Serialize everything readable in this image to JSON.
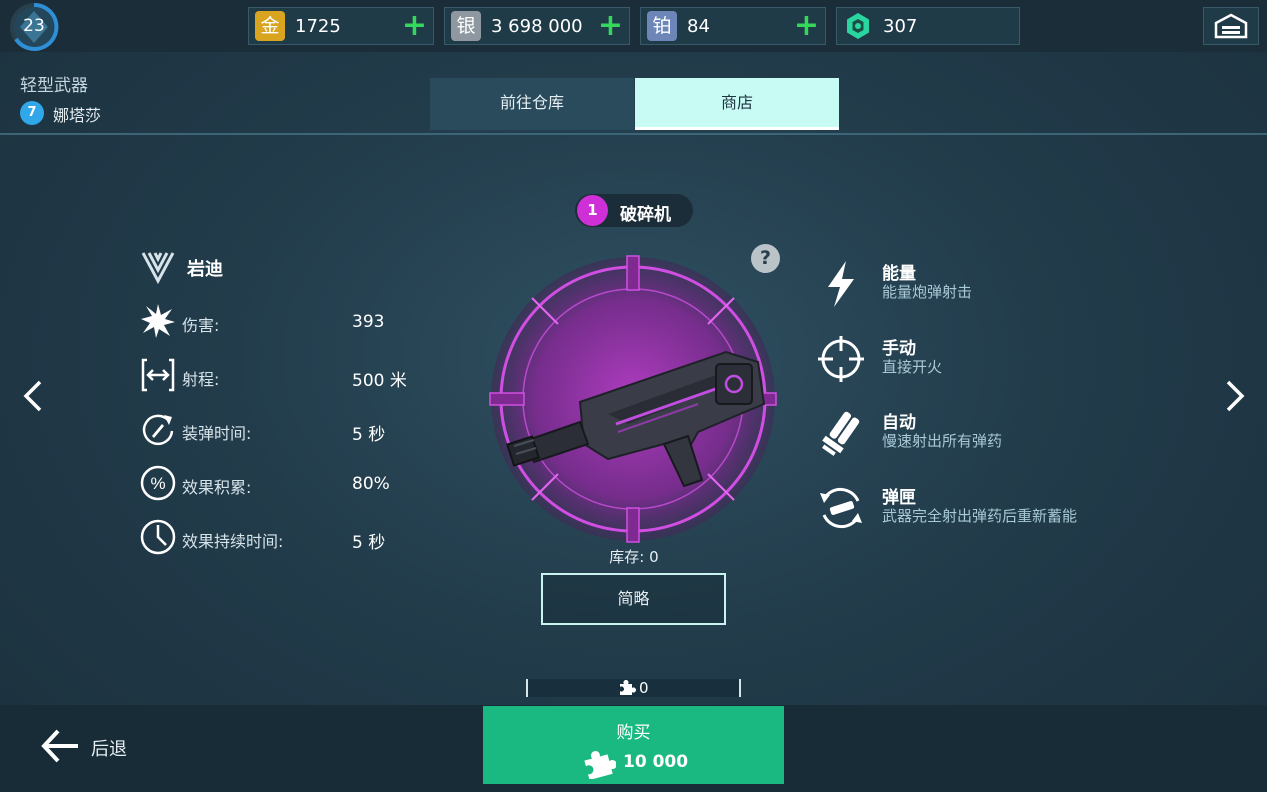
{
  "player": {
    "level": "23"
  },
  "currencies": [
    {
      "icon": "gold-icon",
      "glyph": "金",
      "value": "1725",
      "color": "#d9a521",
      "can_add": true
    },
    {
      "icon": "silver-icon",
      "glyph": "银",
      "value": "3 698 000",
      "color": "#8f98a0",
      "can_add": true
    },
    {
      "icon": "platinum-icon",
      "glyph": "铂",
      "value": "84",
      "color": "#6d86b8",
      "can_add": true
    },
    {
      "icon": "gem-icon",
      "glyph": "",
      "value": "307",
      "color": "#2ad6a0",
      "can_add": false
    }
  ],
  "header": {
    "category": "轻型武器",
    "pilot_level": "7",
    "pilot_name": "娜塔莎",
    "tabs": [
      {
        "label": "前往仓库",
        "active": false
      },
      {
        "label": "商店",
        "active": true
      }
    ]
  },
  "weapon": {
    "rank": "1",
    "name": "破碎机",
    "manufacturer": "岩迪",
    "stats": [
      {
        "icon": "damage-icon",
        "label": "伤害:",
        "value": "393"
      },
      {
        "icon": "range-icon",
        "label": "射程:",
        "value": "500 米"
      },
      {
        "icon": "reload-icon",
        "label": "装弹时间:",
        "value": "5 秒"
      },
      {
        "icon": "percent-icon",
        "label": "效果积累:",
        "value": "80%"
      },
      {
        "icon": "timer-icon",
        "label": "效果持续时间:",
        "value": "5 秒"
      }
    ],
    "features": [
      {
        "icon": "lightning-icon",
        "title": "能量",
        "desc": "能量炮弹射击"
      },
      {
        "icon": "crosshair-icon",
        "title": "手动",
        "desc": "直接开火"
      },
      {
        "icon": "auto-fire-icon",
        "title": "自动",
        "desc": "慢速射出所有弹药"
      },
      {
        "icon": "magazine-icon",
        "title": "弹匣",
        "desc": "武器完全射出弹药后重新蓄能"
      }
    ],
    "stock_label": "库存:",
    "stock_value": "0",
    "brief_label": "简略",
    "accent_color": "#c43fd6"
  },
  "footer": {
    "back_label": "后退",
    "fragments": "0",
    "buy_label": "购买",
    "price": "10 000",
    "buy_color": "#1bb982"
  }
}
